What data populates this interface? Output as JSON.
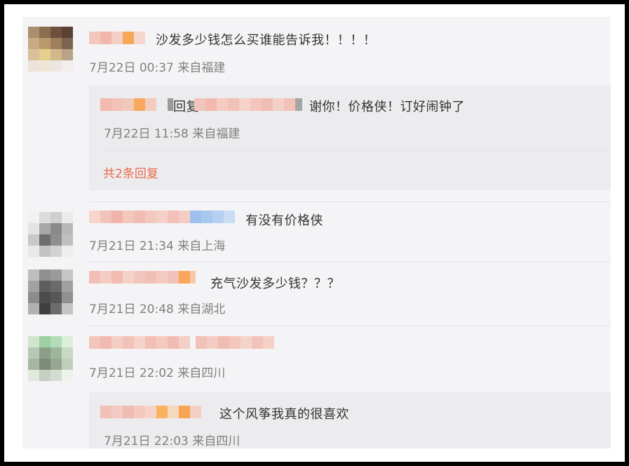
{
  "comments": [
    {
      "text": "沙发多少钱怎么买谁能告诉我！！！！",
      "time": "7月22日 00:37",
      "location": "来自福建",
      "replies": [
        {
          "text_prefix": "回复",
          "text": "谢你！价格侠！订好闹钟了",
          "time": "7月22日 11:58",
          "location": "来自福建"
        }
      ],
      "more_replies": "共2条回复"
    },
    {
      "text": "有没有价格侠",
      "time": "7月21日 21:34",
      "location": "来自上海"
    },
    {
      "text": "充气沙发多少钱？？？",
      "time": "7月21日 20:48",
      "location": "来自湖北"
    },
    {
      "text": "",
      "time": "7月21日 22:02",
      "location": "来自四川",
      "replies": [
        {
          "text": "这个风筝我真的很喜欢",
          "time": "7月21日 22:03",
          "location": "来自四川"
        }
      ]
    }
  ],
  "colors": {
    "frame": "#000000",
    "panel": "#f4f4f6",
    "reply_box": "#ececee",
    "link": "#eb6a4a",
    "meta": "#808080"
  }
}
